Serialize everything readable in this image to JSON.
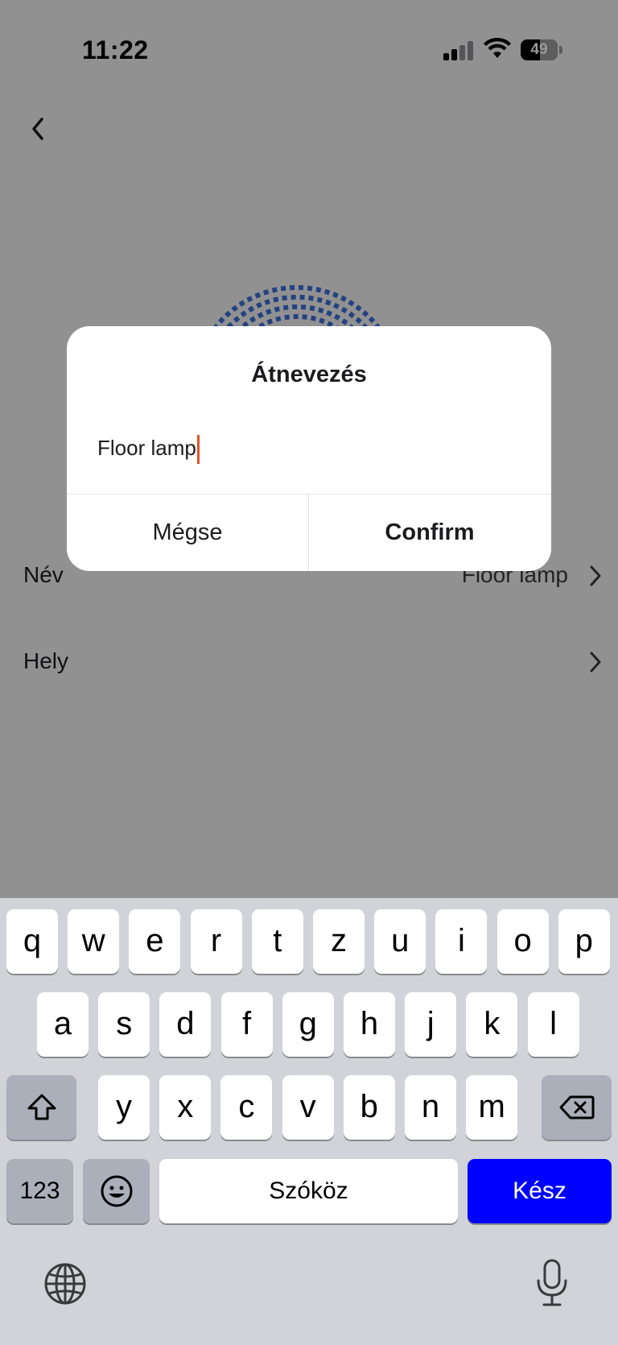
{
  "status_bar": {
    "time": "11:22",
    "battery": "49"
  },
  "settings": {
    "rows": [
      {
        "label": "Név",
        "value": "Floor lamp"
      },
      {
        "label": "Hely",
        "value": ""
      }
    ]
  },
  "dialog": {
    "title": "Átnevezés",
    "input_value": "Floor lamp",
    "cancel_label": "Mégse",
    "confirm_label": "Confirm"
  },
  "keyboard": {
    "row1": [
      "q",
      "w",
      "e",
      "r",
      "t",
      "z",
      "u",
      "i",
      "o",
      "p"
    ],
    "row2": [
      "a",
      "s",
      "d",
      "f",
      "g",
      "h",
      "j",
      "k",
      "l"
    ],
    "row3": [
      "y",
      "x",
      "c",
      "v",
      "b",
      "n",
      "m"
    ],
    "numbers_label": "123",
    "space_label": "Szóköz",
    "done_label": "Kész",
    "done_color": "#0000ff"
  },
  "icons": [
    "back-chevron-icon",
    "chevron-right-icon",
    "signal-icon",
    "wifi-icon",
    "battery-icon",
    "shift-icon",
    "backspace-icon",
    "emoji-icon",
    "globe-icon",
    "microphone-icon"
  ]
}
